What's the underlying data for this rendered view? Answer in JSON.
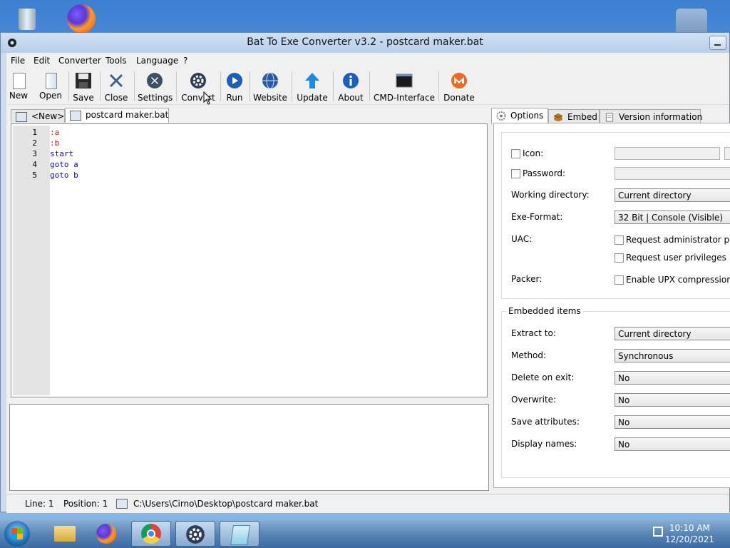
{
  "window": {
    "title": "Bat To Exe Converter v3.2 - postcard maker.bat"
  },
  "menu": [
    "File",
    "Edit",
    "Converter",
    "Tools",
    "Language",
    "?"
  ],
  "toolbar": {
    "new": "New",
    "open": "Open",
    "save": "Save",
    "close": "Close",
    "settings": "Settings",
    "convert": "Convert",
    "run": "Run",
    "website": "Website",
    "update": "Update",
    "about": "About",
    "cmd": "CMD-Interface",
    "donate": "Donate"
  },
  "editor": {
    "tabs": [
      "<New>",
      "postcard maker.bat"
    ],
    "lines": [
      {
        "n": "1",
        "text": ":a"
      },
      {
        "n": "2",
        "text": ":b"
      },
      {
        "n": "3",
        "text": "start"
      },
      {
        "n": "4",
        "text": "goto a"
      },
      {
        "n": "5",
        "text": "goto b"
      }
    ]
  },
  "status": {
    "line": "Line: 1",
    "position": "Position: 1",
    "path": "C:\\Users\\Cirno\\Desktop\\postcard maker.bat"
  },
  "right_tabs": [
    "Options",
    "Embed",
    "Version information"
  ],
  "options": {
    "icon": "Icon:",
    "password": "Password:",
    "working_dir_label": "Working directory:",
    "working_dir_value": "Current directory",
    "exe_format_label": "Exe-Format:",
    "exe_format_value": "32 Bit | Console (Visible)",
    "uac_label": "UAC:",
    "uac_admin": "Request administrator privileges",
    "uac_user": "Request user privileges",
    "packer_label": "Packer:",
    "packer_upx": "Enable UPX compression"
  },
  "embedded": {
    "title": "Embedded items",
    "extract_label": "Extract to:",
    "extract_value": "Current directory",
    "method_label": "Method:",
    "method_value": "Synchronous",
    "delete_label": "Delete on exit:",
    "delete_value": "No",
    "overwrite_label": "Overwrite:",
    "overwrite_value": "No",
    "save_attr_label": "Save attributes:",
    "save_attr_value": "No",
    "display_label": "Display names:",
    "display_value": "No"
  },
  "taskbar": {
    "time": "10:10 AM",
    "date": "12/20/2021"
  },
  "colors": {
    "label_red": "#cc1b1b",
    "keyword_blue": "#1010a8"
  }
}
